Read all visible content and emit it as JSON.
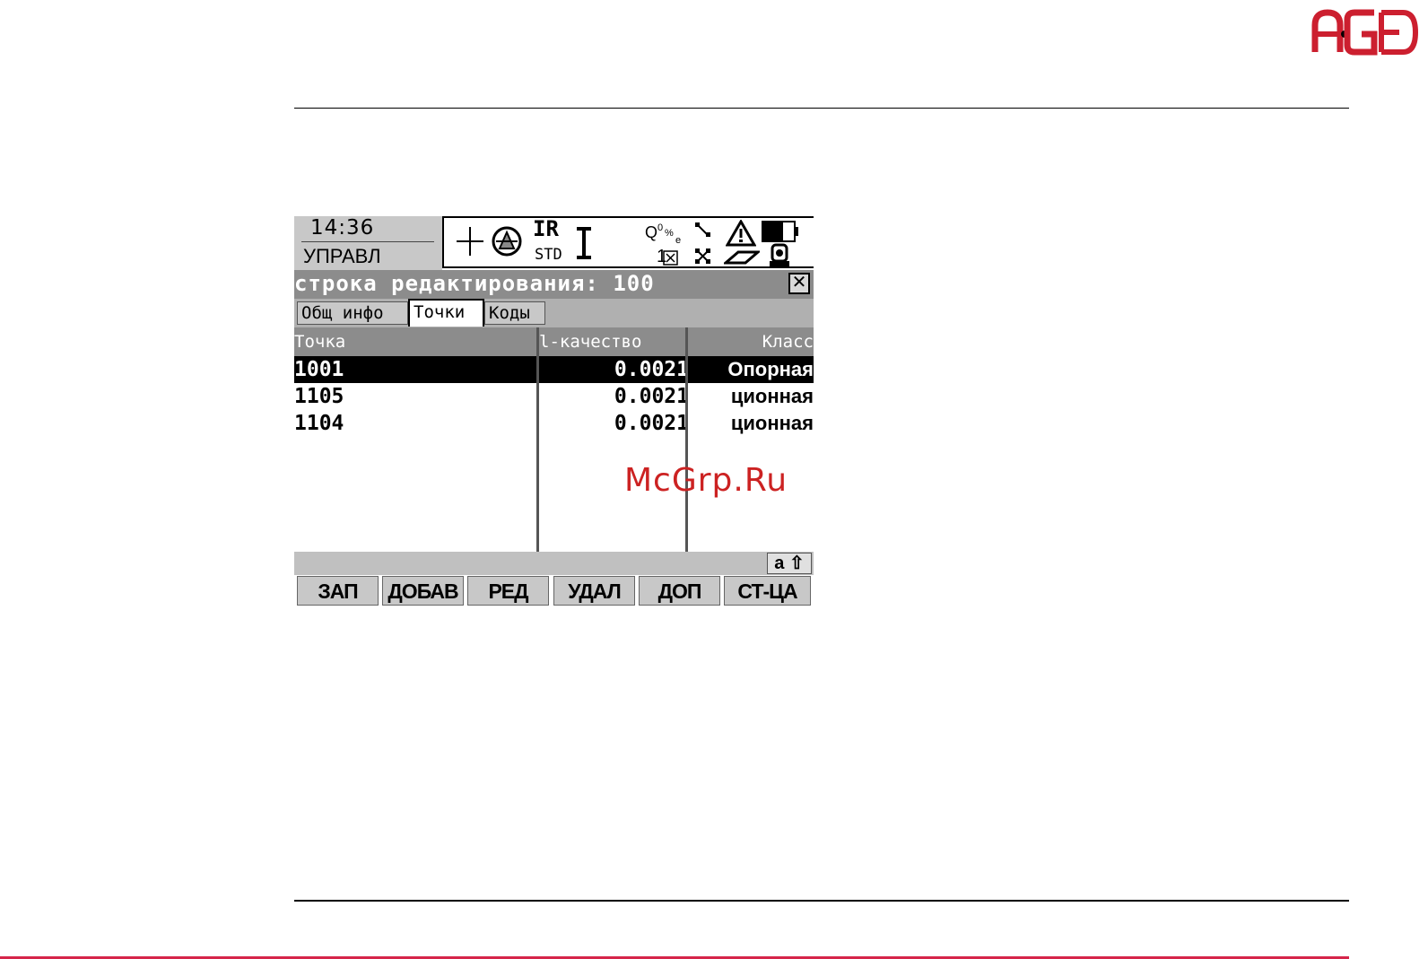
{
  "logo": {
    "text": "AGE"
  },
  "status": {
    "time": "14:36",
    "mode": "УПРАВЛ",
    "measure_mode": "IR",
    "prism": "STD",
    "face": "1",
    "icons": [
      "crosshair-icon",
      "reflector-icon",
      "cursor-icon",
      "quality-icon",
      "link-icon",
      "warning-icon",
      "battery-icon",
      "radio-icon",
      "memory-icon",
      "instrument-icon"
    ]
  },
  "dialog": {
    "title": "строка редактирования: 100",
    "close": "✕"
  },
  "tabs": [
    "Общ инфо",
    "Точки",
    "Коды"
  ],
  "table": {
    "columns": [
      "Точка",
      "l-качество",
      "Класс"
    ],
    "rows": [
      {
        "point": "1001",
        "quality": "0.0021",
        "class": "Опорная"
      },
      {
        "point": "1105",
        "quality": "0.0021",
        "class": "ционная"
      },
      {
        "point": "1104",
        "quality": "0.0021",
        "class": "ционная"
      }
    ]
  },
  "watermark": "McGrp.Ru",
  "input_mode": "a ⇧",
  "softkeys": [
    "ЗАП",
    "ДОБАВ",
    "РЕД",
    "УДАЛ",
    "ДОП",
    "СТ-ЦА"
  ],
  "colors": {
    "accent_red": "#d6254a",
    "logo_red": "#cc1f2f",
    "titlebar_gray": "#8c8c8c"
  }
}
